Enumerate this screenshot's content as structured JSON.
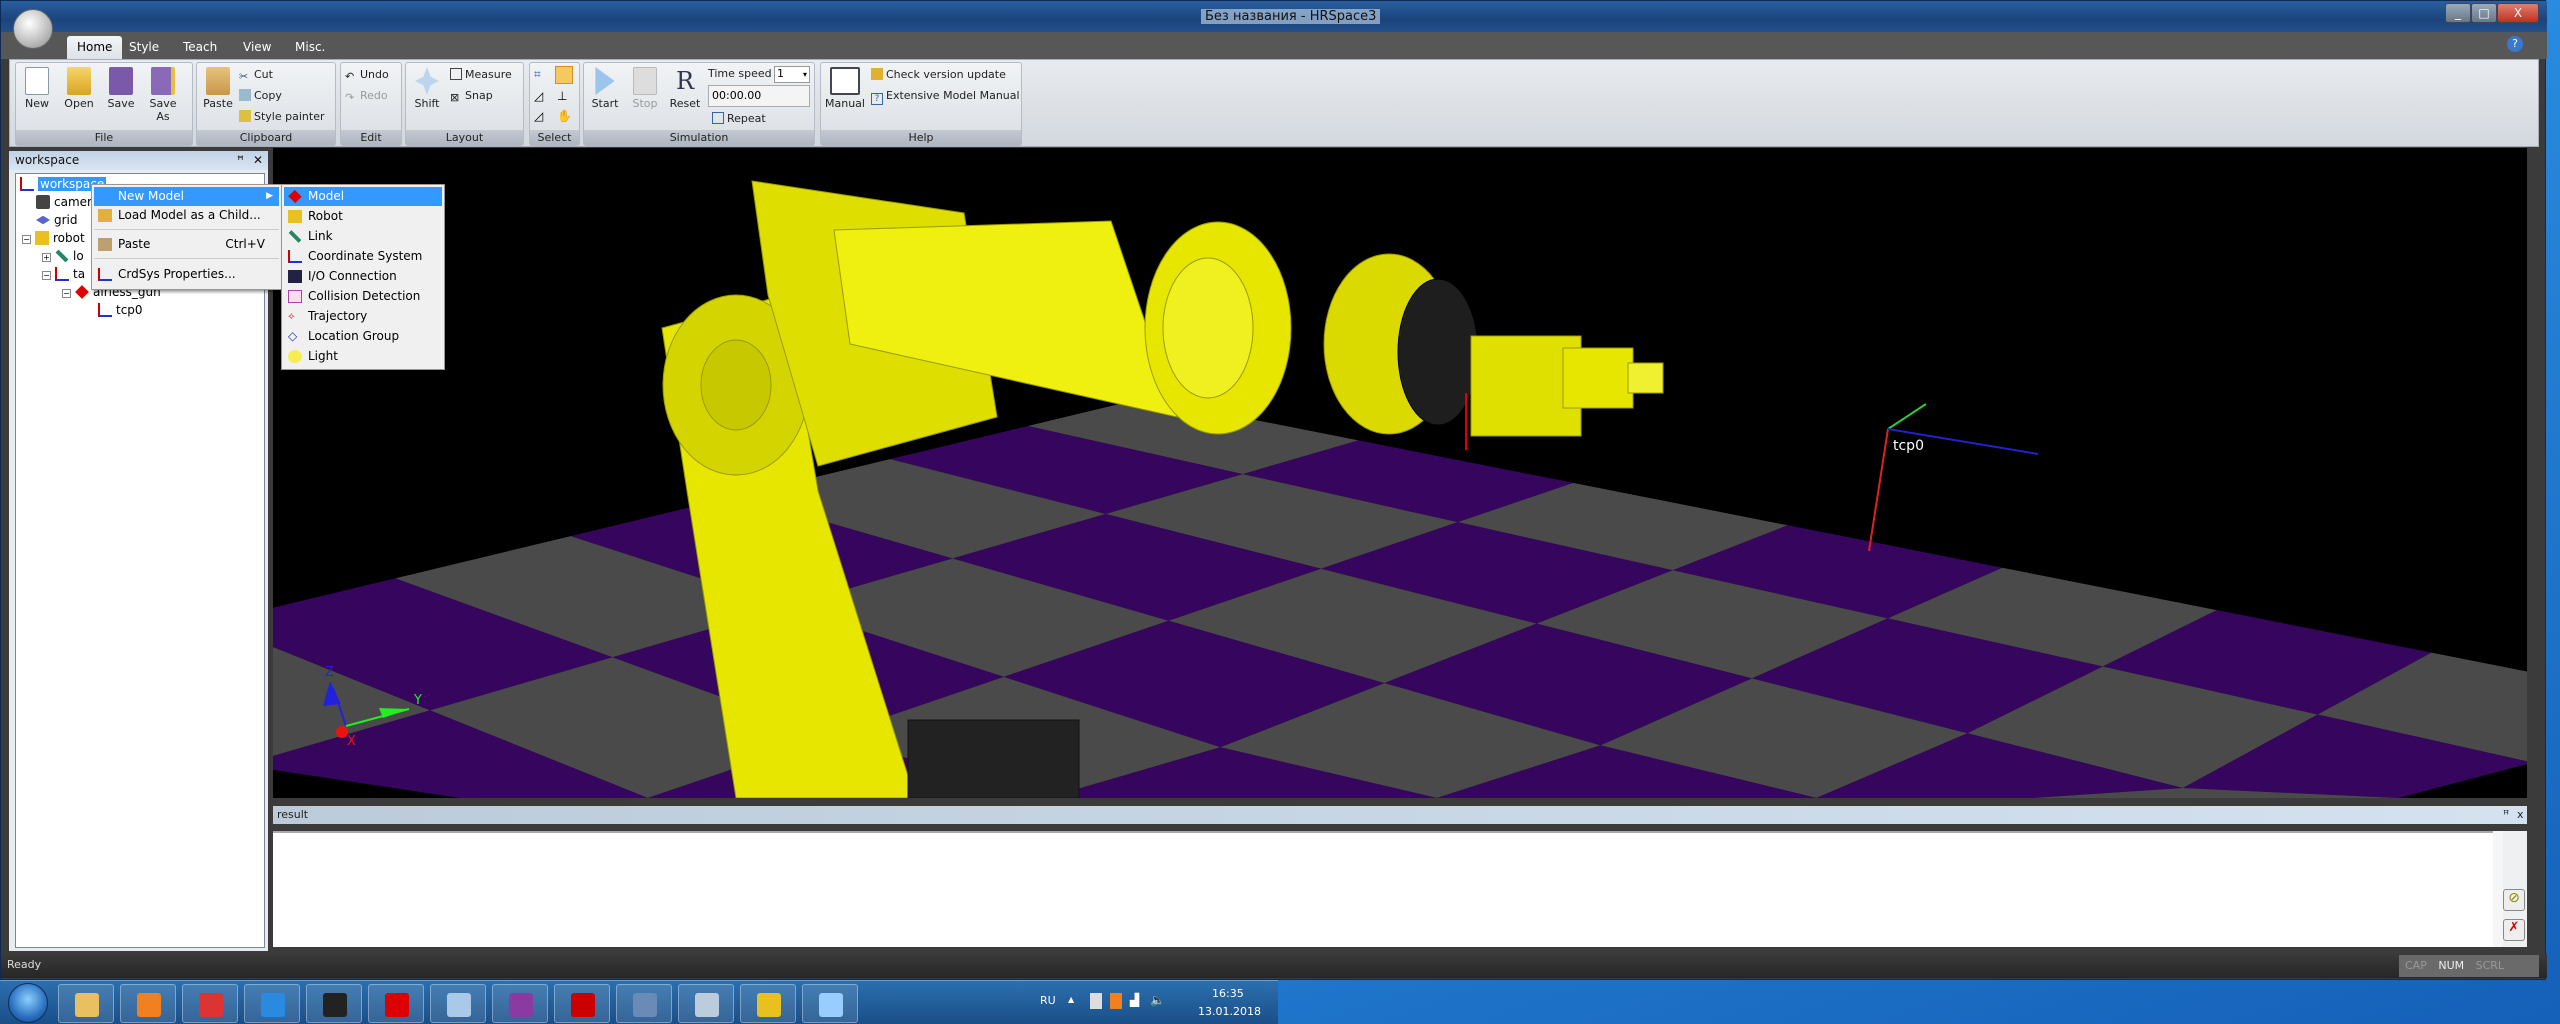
{
  "window": {
    "title": "Без названия - HRSpace3",
    "minimize": "_",
    "maximize": "□",
    "close": "X",
    "help": "?"
  },
  "ribbon": {
    "tabs": [
      {
        "label": "Home",
        "active": true
      },
      {
        "label": "Style"
      },
      {
        "label": "Teach"
      },
      {
        "label": "View"
      },
      {
        "label": "Misc."
      }
    ],
    "groups": {
      "file": "File",
      "clipboard": "Clipboard",
      "edit": "Edit",
      "layout": "Layout",
      "select": "Select",
      "simulation": "Simulation",
      "help": "Help"
    },
    "file": {
      "new": "New",
      "open": "Open",
      "save": "Save",
      "save_as": "Save As"
    },
    "clipboard": {
      "paste": "Paste",
      "cut": "Cut",
      "copy": "Copy",
      "style_painter": "Style painter"
    },
    "edit": {
      "undo": "Undo",
      "redo": "Redo"
    },
    "layout": {
      "shift": "Shift",
      "measure": "Measure",
      "snap": "Snap"
    },
    "simulation": {
      "start": "Start",
      "stop": "Stop",
      "reset": "Reset",
      "time_speed_label": "Time speed",
      "time_speed_value": "1",
      "time": "00:00.00",
      "repeat": "Repeat"
    },
    "help": {
      "manual": "Manual",
      "check_update": "Check version update",
      "model_manual": "Extensive Model Manual"
    }
  },
  "workspace": {
    "title": "workspace",
    "pin": "ꟸ",
    "close": "✕",
    "tree": [
      {
        "label": "workspace",
        "selected": true
      },
      {
        "label": "camera"
      },
      {
        "label": "grid"
      },
      {
        "label": "robot"
      },
      {
        "label": "lo"
      },
      {
        "label": "ta"
      },
      {
        "label": "airless_gun"
      },
      {
        "label": "tcp0"
      }
    ]
  },
  "context_menu": {
    "items": [
      {
        "label": "New Model",
        "highlighted": true
      },
      {
        "label": "Load Model as a Child..."
      },
      {
        "label": "Paste",
        "shortcut": "Ctrl+V"
      },
      {
        "label": "CrdSys Properties..."
      }
    ],
    "submenu": [
      {
        "label": "Model",
        "highlighted": true
      },
      {
        "label": "Robot"
      },
      {
        "label": "Link"
      },
      {
        "label": "Coordinate System"
      },
      {
        "label": "I/O Connection"
      },
      {
        "label": "Collision Detection"
      },
      {
        "label": "Trajectory"
      },
      {
        "label": "Location Group"
      },
      {
        "label": "Light"
      }
    ]
  },
  "viewport": {
    "tcp_label": "tcp0",
    "axis_x": "X",
    "axis_y": "Y",
    "axis_z": "Z",
    "colors": {
      "floor_gray": "#4a4a4a",
      "floor_purple": "#36065e",
      "robot": "#e6e600",
      "background": "#000000"
    }
  },
  "result": {
    "title": "result",
    "pin": "ꟸ",
    "close": "x",
    "text": ""
  },
  "status": {
    "text": "Ready",
    "cap": "CAP",
    "num": "NUM",
    "scrl": "SCRL"
  },
  "taskbar": {
    "apps": [
      "explorer",
      "media-player",
      "chrome",
      "internet-explorer",
      "app-tool",
      "opera",
      "notepad",
      "winrar",
      "acrobat",
      "app-tool-2",
      "calculator",
      "hrspace",
      "paint"
    ],
    "lang": "RU",
    "time": "16:35",
    "date": "13.01.2018"
  }
}
